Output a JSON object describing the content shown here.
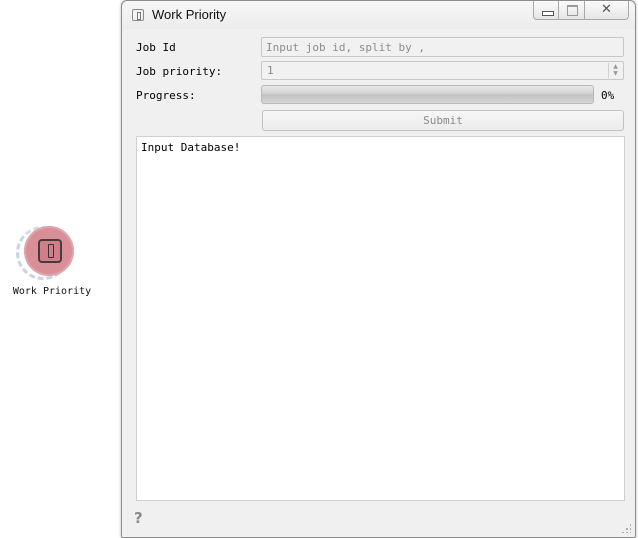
{
  "desktop": {
    "node_label": "Work Priority",
    "node_color": "#d98f98",
    "node_icon": "info-icon"
  },
  "window": {
    "title": "Work Priority",
    "icon": "info-icon",
    "buttons": {
      "minimize": "minimize-icon",
      "maximize": "maximize-icon",
      "close": "✕"
    }
  },
  "form": {
    "job_id_label": "Job Id",
    "job_id_placeholder": "Input job id, split by ,",
    "job_id_value": "",
    "priority_label": "Job priority:",
    "priority_value": "1",
    "progress_label": "Progress:",
    "progress_percent": 0,
    "progress_text": "0%",
    "submit_label": "Submit"
  },
  "log": {
    "text": "Input Database!"
  },
  "footer": {
    "help_glyph": "?"
  }
}
